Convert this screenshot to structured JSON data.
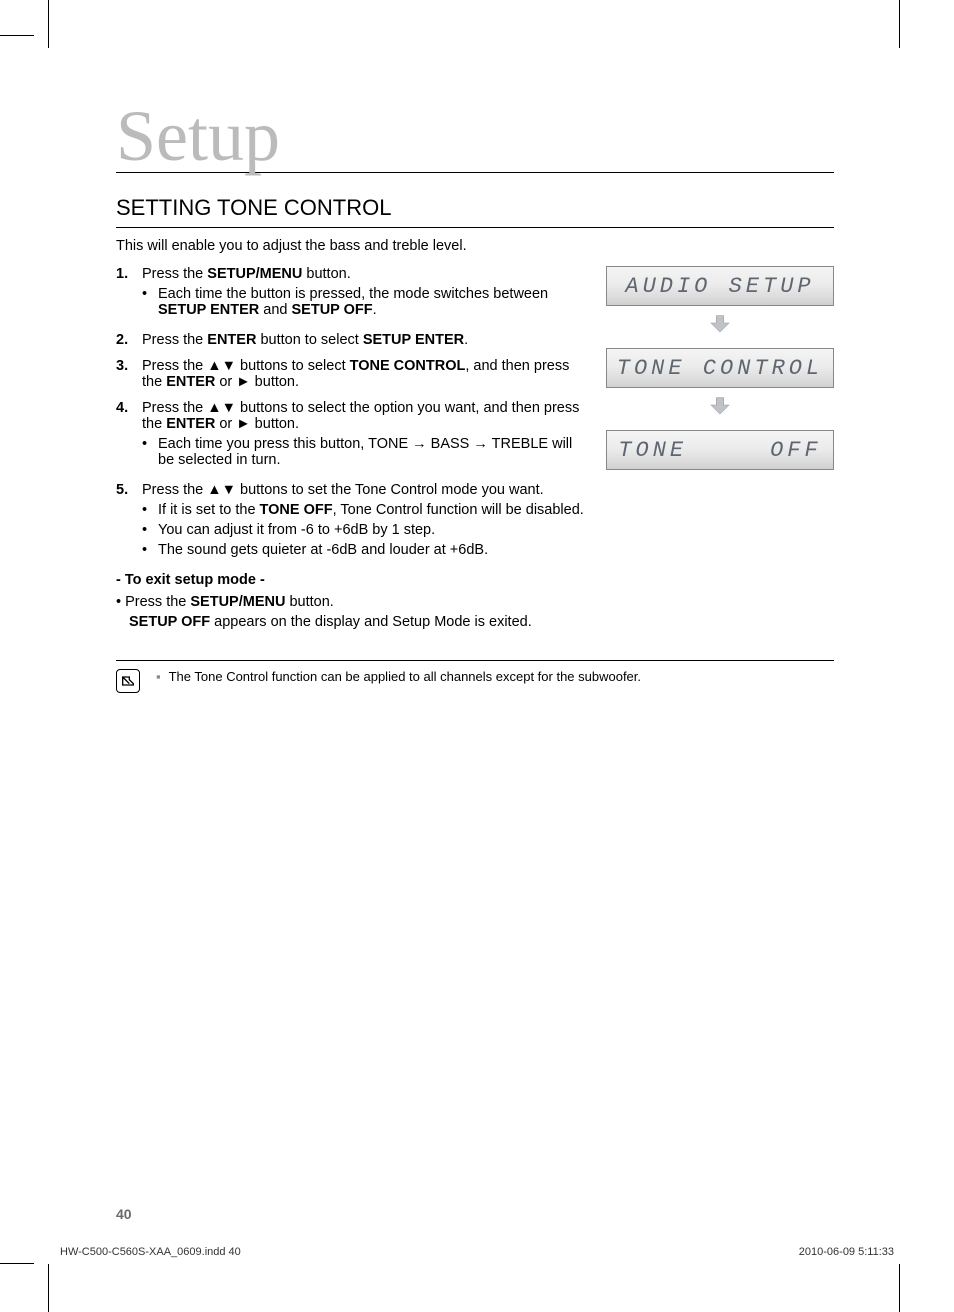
{
  "chapter": "Setup",
  "section_title": "SETTING TONE CONTROL",
  "intro": "This will enable you to adjust the bass and treble level.",
  "steps": {
    "s1": {
      "num": "1.",
      "text_a": "Press the ",
      "bold_a": "SETUP/MENU",
      "text_b": " button.",
      "sub1_a": "Each time the button is pressed, the mode switches between ",
      "sub1_bold1": "SETUP ENTER",
      "sub1_mid": " and ",
      "sub1_bold2": "SETUP OFF",
      "sub1_end": "."
    },
    "s2": {
      "num": "2.",
      "text_a": "Press the ",
      "bold_a": "ENTER",
      "text_b": " button to select ",
      "bold_b": "SETUP ENTER",
      "text_c": "."
    },
    "s3": {
      "num": "3.",
      "text_a": "Press the ",
      "sym": "▲▼",
      "text_b": " buttons to select ",
      "bold_a": "TONE CONTROL",
      "text_c": ", and then press the ",
      "bold_b": "ENTER",
      "text_d": " or ",
      "sym2": "►",
      "text_e": " button."
    },
    "s4": {
      "num": "4.",
      "text_a": "Press the ",
      "sym": "▲▼",
      "text_b": " buttons to select the option you want, and then press the ",
      "bold_a": "ENTER",
      "text_c": " or ",
      "sym2": "►",
      "text_d": " button.",
      "sub1_a": "Each time you press this button, TONE ",
      "arrow": "→",
      "sub1_b": " BASS ",
      "sub1_c": " TREBLE will be selected in turn."
    },
    "s5": {
      "num": "5.",
      "text_a": "Press the ",
      "sym": "▲▼",
      "text_b": " buttons to set the Tone Control mode you want.",
      "sub1_a": "If it is set to the ",
      "sub1_bold": "TONE OFF",
      "sub1_b": ", Tone Control function will be disabled.",
      "sub2": "You can adjust it from -6 to +6dB by 1 step.",
      "sub3": "The sound gets quieter at -6dB and louder at +6dB."
    }
  },
  "exit": {
    "heading": "- To exit setup mode -",
    "line1_a": "• Press the ",
    "line1_bold": "SETUP/MENU",
    "line1_b": " button.",
    "line2_bold": "SETUP OFF",
    "line2_a": " appears on the display and Setup Mode is exited."
  },
  "note": {
    "bullet": "▪",
    "text": "The Tone Control function can be applied to all channels except for the subwoofer."
  },
  "lcd": {
    "d1": "AUDIO  SETUP",
    "d2": "TONE  CONTROL",
    "d3_left": "TONE",
    "d3_right": "OFF"
  },
  "page_number": "40",
  "footer_left": "HW-C500-C560S-XAA_0609.indd   40",
  "footer_right": "2010-06-09     5:11:33"
}
